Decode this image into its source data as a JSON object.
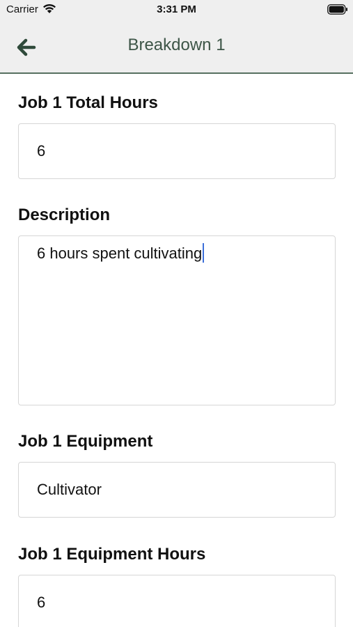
{
  "status_bar": {
    "carrier": "Carrier",
    "time": "3:31 PM"
  },
  "nav": {
    "title": "Breakdown 1",
    "back_icon": "arrow-left-icon"
  },
  "form": {
    "total_hours": {
      "label": "Job 1 Total Hours",
      "value": "6"
    },
    "description": {
      "label": "Description",
      "value": "6 hours spent cultivating"
    },
    "equipment": {
      "label": "Job 1 Equipment",
      "value": "Cultivator"
    },
    "equipment_hours": {
      "label": "Job 1 Equipment Hours",
      "value": "6"
    }
  },
  "colors": {
    "header_bg": "#efefef",
    "header_border": "#56705f",
    "accent": "#2f4a3a",
    "caret": "#3d6fd9"
  }
}
